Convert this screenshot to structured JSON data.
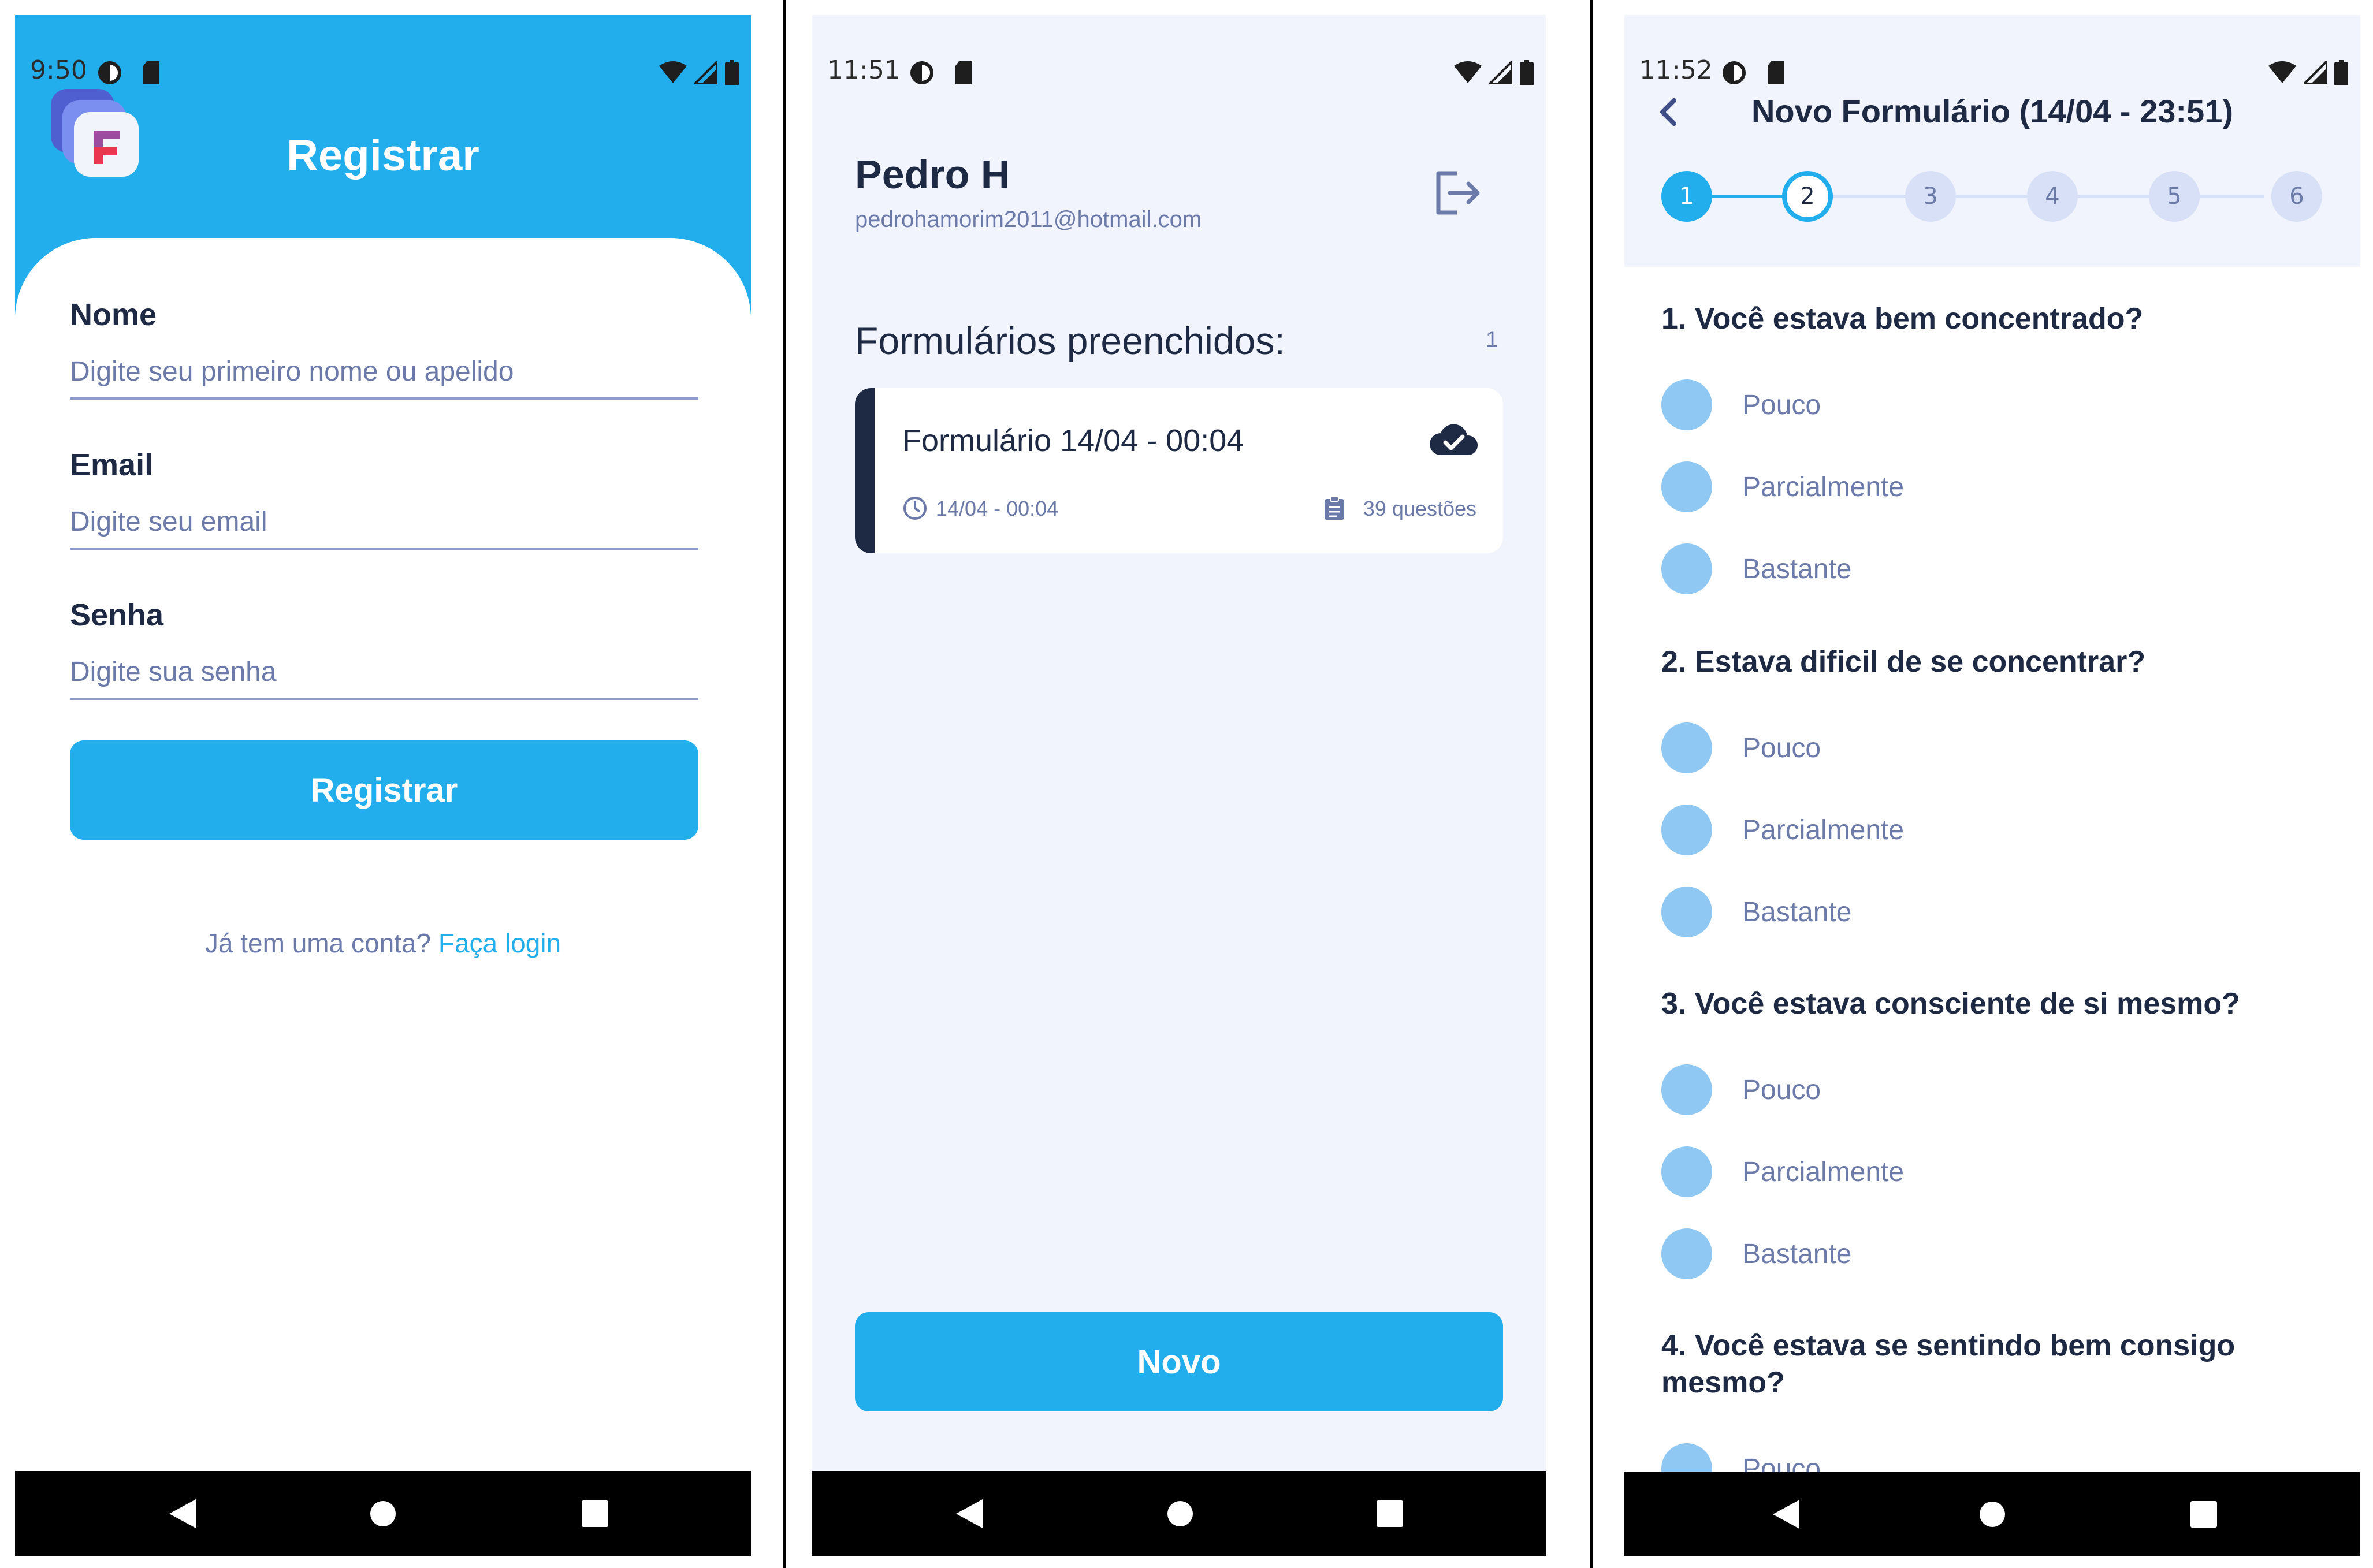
{
  "screens": {
    "register": {
      "status_time": "9:50",
      "title": "Registrar",
      "fields": [
        {
          "label": "Nome",
          "placeholder": "Digite seu primeiro nome ou apelido"
        },
        {
          "label": "Email",
          "placeholder": "Digite seu email"
        },
        {
          "label": "Senha",
          "placeholder": "Digite sua senha"
        }
      ],
      "submit_label": "Registrar",
      "login_prompt": "Já tem uma conta?",
      "login_link": "Faça login"
    },
    "home": {
      "status_time": "11:51",
      "user_name": "Pedro H",
      "user_email": "pedrohamorim2011@hotmail.com",
      "section_title": "Formulários preenchidos:",
      "section_count": "1",
      "forms": [
        {
          "title": "Formulário 14/04 - 00:04",
          "date": "14/04 - 00:04",
          "questions": "39 questões",
          "synced_icon": "cloud-check-icon"
        }
      ],
      "new_button": "Novo"
    },
    "form": {
      "status_time": "11:52",
      "title": "Novo Formulário (14/04 - 23:51)",
      "steps": [
        "1",
        "2",
        "3",
        "4",
        "5",
        "6"
      ],
      "current_step": 2,
      "questions": [
        {
          "text": "1. Você estava bem concentrado?",
          "options": [
            "Pouco",
            "Parcialmente",
            "Bastante"
          ]
        },
        {
          "text": "2. Estava dificil de se concentrar?",
          "options": [
            "Pouco",
            "Parcialmente",
            "Bastante"
          ]
        },
        {
          "text": "3. Você estava consciente de si mesmo?",
          "options": [
            "Pouco",
            "Parcialmente",
            "Bastante"
          ]
        },
        {
          "text": "4. Você estava se sentindo bem consigo mesmo?",
          "options": [
            "Pouco"
          ]
        }
      ]
    }
  },
  "colors": {
    "accent": "#22aeec",
    "dark_text": "#1e2a44",
    "muted_text": "#6b7aa8",
    "screen_bg": "#f1f4fd",
    "radio_fill": "#8fc8f3"
  }
}
